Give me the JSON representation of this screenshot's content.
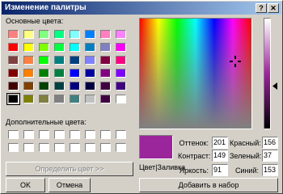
{
  "dialog": {
    "title": "Изменение палитры",
    "help_label": "?",
    "close_label": "✕"
  },
  "basic": {
    "label": "Основные цвета:",
    "colors": [
      "#ff8080",
      "#ffff80",
      "#80ff80",
      "#00ff80",
      "#80ffff",
      "#0080ff",
      "#ff80c0",
      "#ff80ff",
      "#ff0000",
      "#ffff00",
      "#80ff00",
      "#00ff40",
      "#00ffff",
      "#0080c0",
      "#8080c0",
      "#ff00ff",
      "#804040",
      "#ff8040",
      "#00ff00",
      "#008080",
      "#004080",
      "#8080ff",
      "#800040",
      "#ff0080",
      "#800000",
      "#ff8000",
      "#008000",
      "#008040",
      "#0000ff",
      "#0000a0",
      "#800080",
      "#8000ff",
      "#400000",
      "#804000",
      "#004000",
      "#004040",
      "#000080",
      "#000040",
      "#400040",
      "#400080",
      "#000000",
      "#808000",
      "#808040",
      "#808080",
      "#408080",
      "#c0c0c0",
      "#400040",
      "#ffffff"
    ],
    "selected_index": 40
  },
  "custom": {
    "label": "Дополнительные цвета:",
    "colors": [
      "#ffffff",
      "#ffffff",
      "#ffffff",
      "#ffffff",
      "#ffffff",
      "#ffffff",
      "#ffffff",
      "#ffffff",
      "#ffffff",
      "#ffffff",
      "#ffffff",
      "#ffffff",
      "#ffffff",
      "#ffffff",
      "#ffffff",
      "#ffffff"
    ]
  },
  "buttons": {
    "define": "Определить цвет >>",
    "ok": "OK",
    "cancel": "Отмена",
    "add": "Добавить в набор"
  },
  "preview": {
    "label": "Цвет|Заливка",
    "color": "#9b259a"
  },
  "values": {
    "hue_label": "Оттенок:",
    "hue": "201",
    "sat_label": "Контраст:",
    "sat": "149",
    "lum_label": "Яркость:",
    "lum": "91",
    "red_label": "Красный:",
    "red": "156",
    "green_label": "Зеленый:",
    "green": "37",
    "blue_label": "Синий:",
    "blue": "153"
  }
}
